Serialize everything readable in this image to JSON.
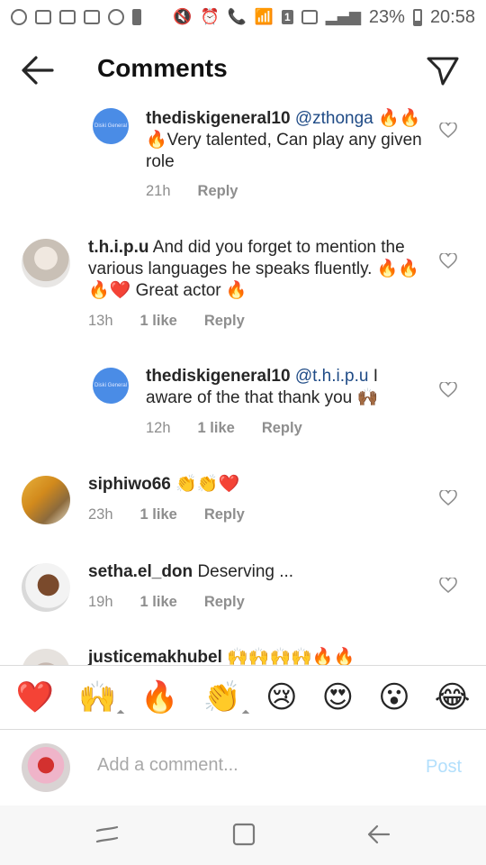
{
  "status_bar": {
    "battery": "23%",
    "time": "20:58",
    "sim_badge": "1"
  },
  "header": {
    "title": "Comments"
  },
  "comments": [
    {
      "username": "thediskigeneral10",
      "mention": "@zthonga",
      "text": "🔥🔥🔥Very talented, Can play any given role",
      "time": "21h",
      "likes": "",
      "reply": "Reply",
      "avatar_text": "Diski General"
    },
    {
      "username": "t.h.i.p.u",
      "mention": "",
      "text": "And did you forget to mention the various languages he speaks fluently. 🔥🔥🔥❤️ Great actor 🔥",
      "time": "13h",
      "likes": "1 like",
      "reply": "Reply"
    },
    {
      "username": "thediskigeneral10",
      "mention": "@t.h.i.p.u",
      "text": "I aware of the that thank you 🙌🏾",
      "time": "12h",
      "likes": "1 like",
      "reply": "Reply",
      "avatar_text": "Diski General"
    },
    {
      "username": "siphiwo66",
      "mention": "",
      "text": "👏👏❤️",
      "time": "23h",
      "likes": "1 like",
      "reply": "Reply"
    },
    {
      "username": "setha.el_don",
      "mention": "",
      "text": "Deserving ...",
      "time": "19h",
      "likes": "1 like",
      "reply": "Reply"
    },
    {
      "username": "justicemakhubel",
      "mention": "",
      "text": "🙌🙌🙌🙌🔥🔥",
      "time": "",
      "likes": "",
      "reply": ""
    }
  ],
  "emoji_bar": [
    "❤️",
    "🙌",
    "🔥",
    "👏",
    "😢",
    "😍",
    "😮",
    "😂"
  ],
  "composer": {
    "placeholder": "Add a comment...",
    "post_label": "Post"
  },
  "colors": {
    "accent_post_disabled": "#b2dffc",
    "mention": "#1f4b86",
    "meta": "#8e8e8e"
  }
}
